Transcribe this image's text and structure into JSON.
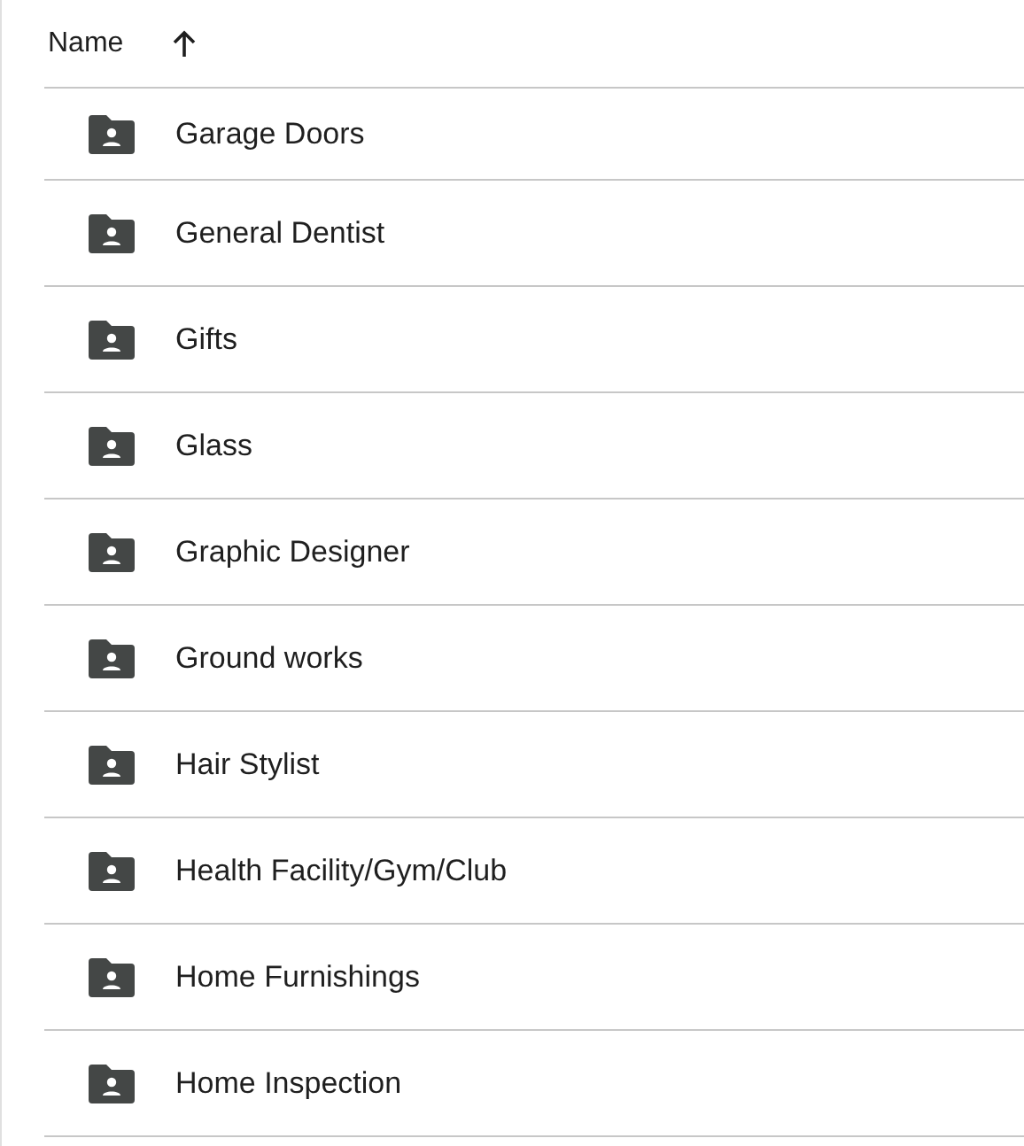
{
  "header": {
    "label": "Name",
    "sort_ascending": true
  },
  "folders": [
    {
      "name": "Garage Doors"
    },
    {
      "name": "General Dentist"
    },
    {
      "name": "Gifts"
    },
    {
      "name": "Glass"
    },
    {
      "name": "Graphic Designer"
    },
    {
      "name": "Ground works"
    },
    {
      "name": "Hair Stylist"
    },
    {
      "name": "Health Facility/Gym/Club"
    },
    {
      "name": "Home Furnishings"
    },
    {
      "name": "Home Inspection"
    }
  ]
}
